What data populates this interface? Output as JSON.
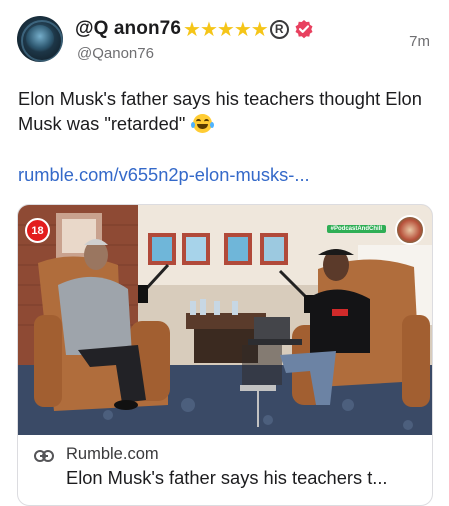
{
  "post": {
    "display_name": "@Q anon76",
    "handle": "@Qanon76",
    "timestamp": "7m",
    "stars": [
      "★",
      "★",
      "★",
      "★",
      "★"
    ],
    "registered_mark": "R",
    "text": "Elon Musk's father says his teachers thought Elon Musk was \"retarded\"",
    "emoji_icon": "tears-of-joy-emoji",
    "link": "rumble.com/v655n2p-elon-musks-..."
  },
  "card": {
    "video_badge": "18",
    "podcast_tag": "#PodcastAndChill",
    "domain": "Rumble.com",
    "title": "Elon Musk's father says his teachers t...",
    "link_icon": "link-icon"
  },
  "colors": {
    "star": "#f5c518",
    "verified": "#e8415f",
    "link": "#3469c9",
    "badge": "#e31d1d",
    "podcast_tag": "#2fae55"
  }
}
